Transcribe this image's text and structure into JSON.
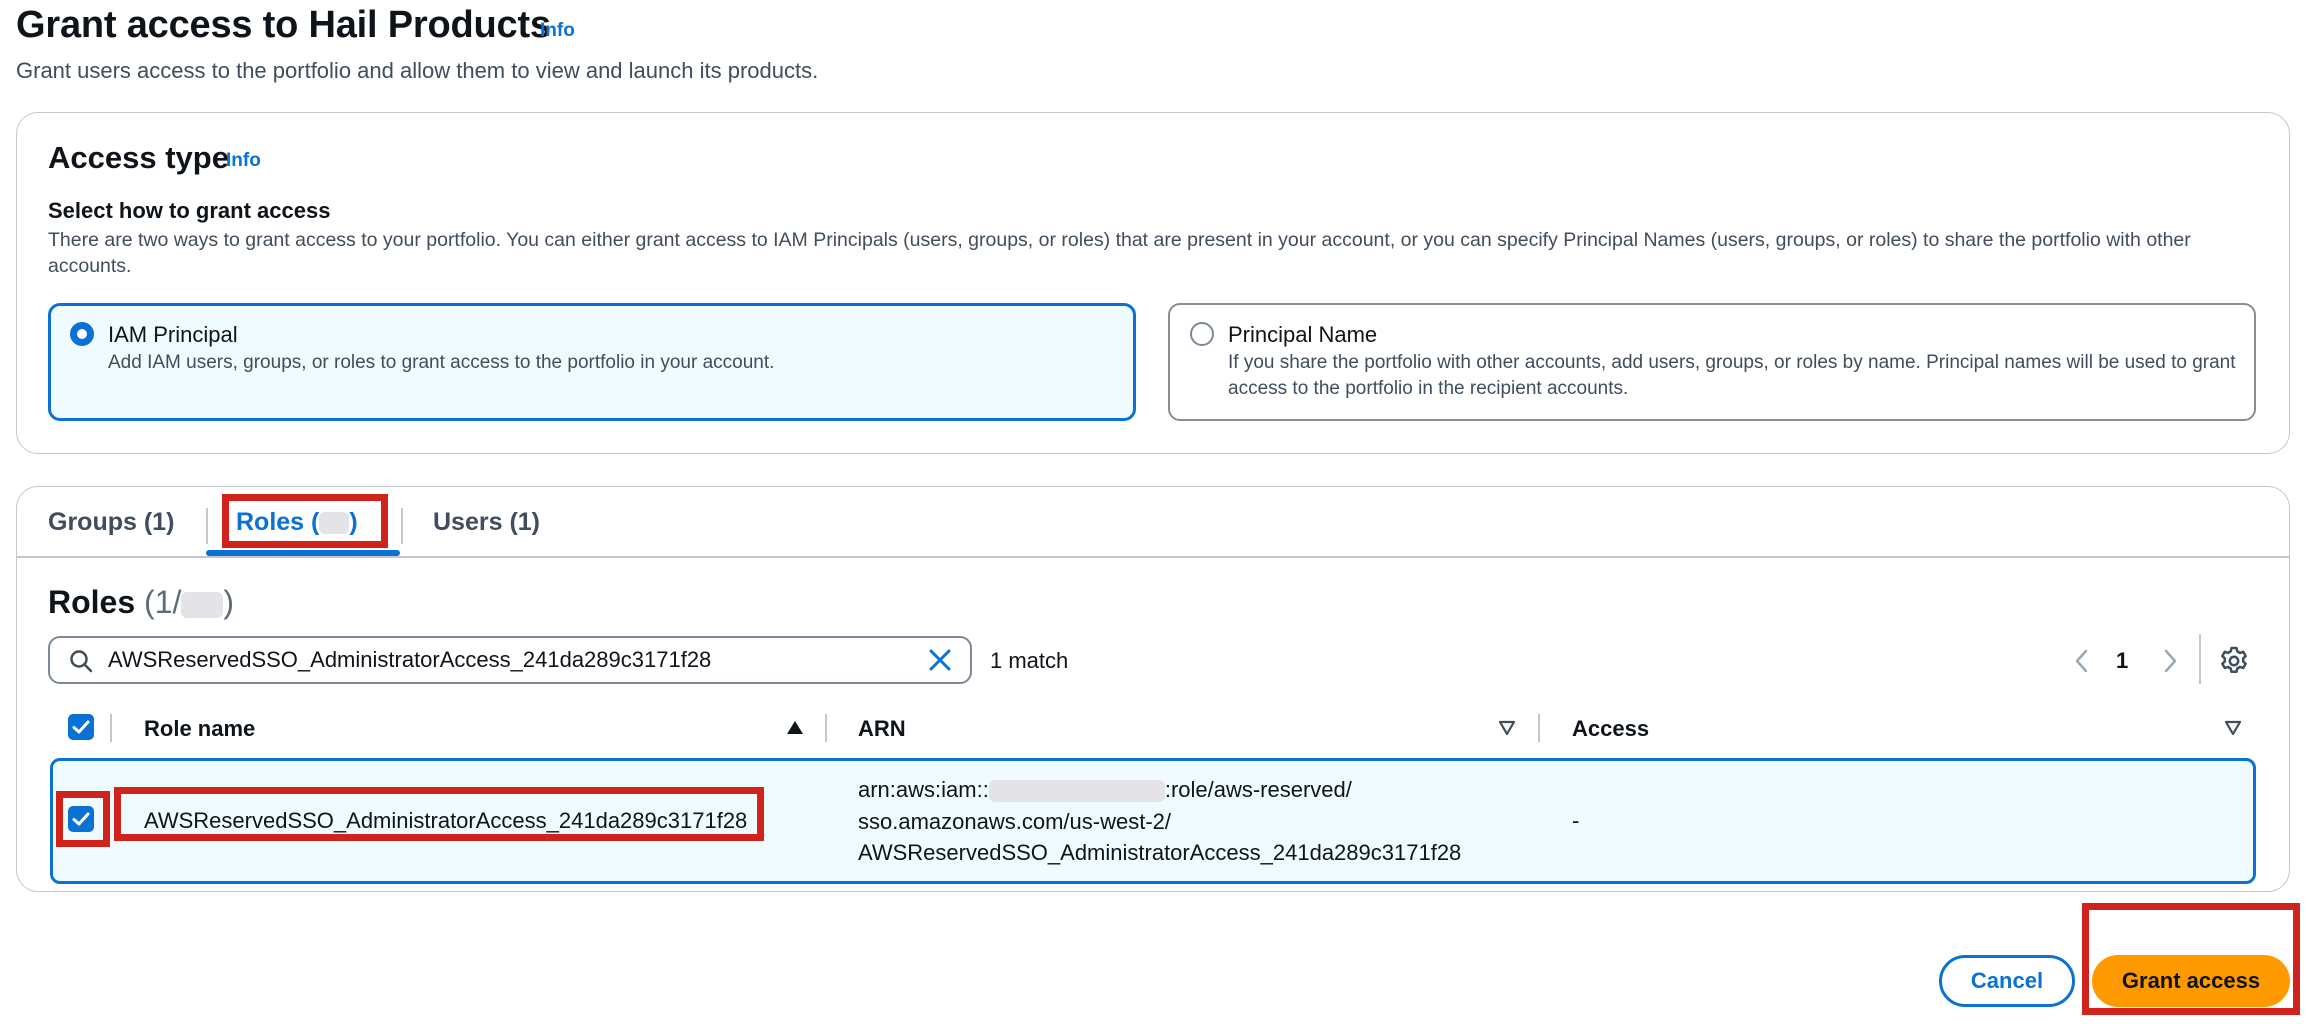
{
  "header": {
    "title": "Grant access to Hail Products",
    "info": "Info",
    "description": "Grant users access to the portfolio and allow them to view and launch its products."
  },
  "access_type": {
    "title": "Access type",
    "info": "Info",
    "select_label": "Select how to grant access",
    "select_description": "There are two ways to grant access to your portfolio. You can either grant access to IAM Principals (users, groups, or roles) that are present in your account, or you can specify Principal Names (users, groups, or roles) to share the portfolio with other accounts.",
    "options": [
      {
        "label": "IAM Principal",
        "description": "Add IAM users, groups, or roles to grant access to the portfolio in your account.",
        "selected": true
      },
      {
        "label": "Principal Name",
        "description": "If you share the portfolio with other accounts, add users, groups, or roles by name. Principal names will be used to grant access to the portfolio in the recipient accounts.",
        "selected": false
      }
    ]
  },
  "tabs": {
    "groups": "Groups (1)",
    "roles_prefix": "Roles (",
    "roles_suffix": ")",
    "users": "Users (1)",
    "active": "roles"
  },
  "roles": {
    "title": "Roles",
    "count_prefix": "(1/",
    "count_suffix": ")",
    "search_value": "AWSReservedSSO_AdministratorAccess_241da289c3171f28",
    "match_text": "1 match",
    "page": "1",
    "columns": [
      "Role name",
      "ARN",
      "Access"
    ],
    "rows": [
      {
        "role_name": "AWSReservedSSO_AdministratorAccess_241da289c3171f28",
        "arn_line1_prefix": "arn:aws:iam::",
        "arn_line1_suffix": ":role/aws-reserved/",
        "arn_line2": "sso.amazonaws.com/us-west-2/",
        "arn_line3": "AWSReservedSSO_AdministratorAccess_241da289c3171f28",
        "access": "-",
        "selected": true
      }
    ]
  },
  "footer": {
    "cancel": "Cancel",
    "grant": "Grant access"
  },
  "colors": {
    "accent": "#0972d3",
    "primary_button": "#ff9900",
    "highlight": "#d0231b"
  }
}
